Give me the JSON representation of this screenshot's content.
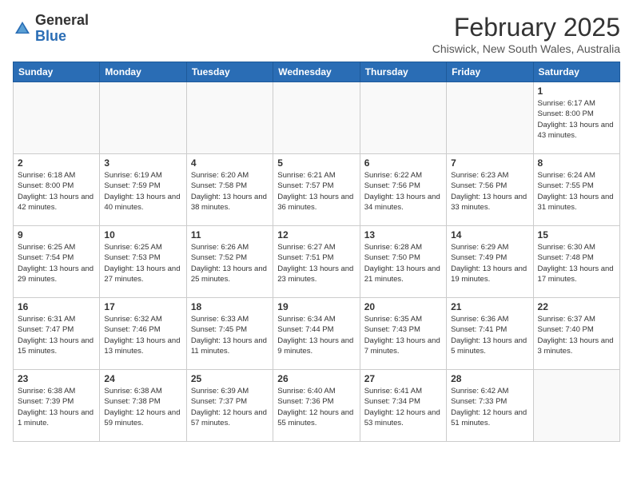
{
  "header": {
    "logo_general": "General",
    "logo_blue": "Blue",
    "month_title": "February 2025",
    "location": "Chiswick, New South Wales, Australia"
  },
  "weekdays": [
    "Sunday",
    "Monday",
    "Tuesday",
    "Wednesday",
    "Thursday",
    "Friday",
    "Saturday"
  ],
  "weeks": [
    [
      {
        "day": "",
        "info": ""
      },
      {
        "day": "",
        "info": ""
      },
      {
        "day": "",
        "info": ""
      },
      {
        "day": "",
        "info": ""
      },
      {
        "day": "",
        "info": ""
      },
      {
        "day": "",
        "info": ""
      },
      {
        "day": "1",
        "info": "Sunrise: 6:17 AM\nSunset: 8:00 PM\nDaylight: 13 hours\nand 43 minutes."
      }
    ],
    [
      {
        "day": "2",
        "info": "Sunrise: 6:18 AM\nSunset: 8:00 PM\nDaylight: 13 hours\nand 42 minutes."
      },
      {
        "day": "3",
        "info": "Sunrise: 6:19 AM\nSunset: 7:59 PM\nDaylight: 13 hours\nand 40 minutes."
      },
      {
        "day": "4",
        "info": "Sunrise: 6:20 AM\nSunset: 7:58 PM\nDaylight: 13 hours\nand 38 minutes."
      },
      {
        "day": "5",
        "info": "Sunrise: 6:21 AM\nSunset: 7:57 PM\nDaylight: 13 hours\nand 36 minutes."
      },
      {
        "day": "6",
        "info": "Sunrise: 6:22 AM\nSunset: 7:56 PM\nDaylight: 13 hours\nand 34 minutes."
      },
      {
        "day": "7",
        "info": "Sunrise: 6:23 AM\nSunset: 7:56 PM\nDaylight: 13 hours\nand 33 minutes."
      },
      {
        "day": "8",
        "info": "Sunrise: 6:24 AM\nSunset: 7:55 PM\nDaylight: 13 hours\nand 31 minutes."
      }
    ],
    [
      {
        "day": "9",
        "info": "Sunrise: 6:25 AM\nSunset: 7:54 PM\nDaylight: 13 hours\nand 29 minutes."
      },
      {
        "day": "10",
        "info": "Sunrise: 6:25 AM\nSunset: 7:53 PM\nDaylight: 13 hours\nand 27 minutes."
      },
      {
        "day": "11",
        "info": "Sunrise: 6:26 AM\nSunset: 7:52 PM\nDaylight: 13 hours\nand 25 minutes."
      },
      {
        "day": "12",
        "info": "Sunrise: 6:27 AM\nSunset: 7:51 PM\nDaylight: 13 hours\nand 23 minutes."
      },
      {
        "day": "13",
        "info": "Sunrise: 6:28 AM\nSunset: 7:50 PM\nDaylight: 13 hours\nand 21 minutes."
      },
      {
        "day": "14",
        "info": "Sunrise: 6:29 AM\nSunset: 7:49 PM\nDaylight: 13 hours\nand 19 minutes."
      },
      {
        "day": "15",
        "info": "Sunrise: 6:30 AM\nSunset: 7:48 PM\nDaylight: 13 hours\nand 17 minutes."
      }
    ],
    [
      {
        "day": "16",
        "info": "Sunrise: 6:31 AM\nSunset: 7:47 PM\nDaylight: 13 hours\nand 15 minutes."
      },
      {
        "day": "17",
        "info": "Sunrise: 6:32 AM\nSunset: 7:46 PM\nDaylight: 13 hours\nand 13 minutes."
      },
      {
        "day": "18",
        "info": "Sunrise: 6:33 AM\nSunset: 7:45 PM\nDaylight: 13 hours\nand 11 minutes."
      },
      {
        "day": "19",
        "info": "Sunrise: 6:34 AM\nSunset: 7:44 PM\nDaylight: 13 hours\nand 9 minutes."
      },
      {
        "day": "20",
        "info": "Sunrise: 6:35 AM\nSunset: 7:43 PM\nDaylight: 13 hours\nand 7 minutes."
      },
      {
        "day": "21",
        "info": "Sunrise: 6:36 AM\nSunset: 7:41 PM\nDaylight: 13 hours\nand 5 minutes."
      },
      {
        "day": "22",
        "info": "Sunrise: 6:37 AM\nSunset: 7:40 PM\nDaylight: 13 hours\nand 3 minutes."
      }
    ],
    [
      {
        "day": "23",
        "info": "Sunrise: 6:38 AM\nSunset: 7:39 PM\nDaylight: 13 hours\nand 1 minute."
      },
      {
        "day": "24",
        "info": "Sunrise: 6:38 AM\nSunset: 7:38 PM\nDaylight: 12 hours\nand 59 minutes."
      },
      {
        "day": "25",
        "info": "Sunrise: 6:39 AM\nSunset: 7:37 PM\nDaylight: 12 hours\nand 57 minutes."
      },
      {
        "day": "26",
        "info": "Sunrise: 6:40 AM\nSunset: 7:36 PM\nDaylight: 12 hours\nand 55 minutes."
      },
      {
        "day": "27",
        "info": "Sunrise: 6:41 AM\nSunset: 7:34 PM\nDaylight: 12 hours\nand 53 minutes."
      },
      {
        "day": "28",
        "info": "Sunrise: 6:42 AM\nSunset: 7:33 PM\nDaylight: 12 hours\nand 51 minutes."
      },
      {
        "day": "",
        "info": ""
      }
    ]
  ]
}
